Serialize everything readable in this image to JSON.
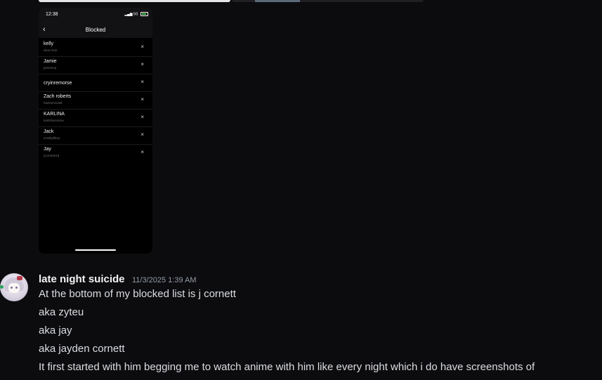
{
  "phone_screenshot": {
    "time": "12:38",
    "status_icons": "5G",
    "title": "Blocked",
    "back_icon": "chevron-left-icon",
    "blocked_users": [
      {
        "name": "kelly",
        "handle": "dixon.bxtr"
      },
      {
        "name": "Jamie",
        "handle": "jamie2up"
      },
      {
        "name": "cryinremorse",
        "handle": ""
      },
      {
        "name": "Zach roberts",
        "handle": "hack3mrsn9k"
      },
      {
        "name": "KARLINA",
        "handle": "karlisherninow"
      },
      {
        "name": "Jack",
        "handle": "smallyiltboy"
      },
      {
        "name": "Jay",
        "handle": "jcornett218"
      }
    ],
    "remove_symbol": "×"
  },
  "message": {
    "username": "late night suicide",
    "timestamp": "11/3/2025 1:39 AM",
    "lines": [
      "At the bottom of my blocked list is j cornett",
      "aka zyteu",
      "aka jay",
      "aka jayden cornett",
      "It first started with him begging me to watch anime with him like every night which i do have screenshots of"
    ]
  },
  "colors": {
    "background": "#0c0c0f",
    "username": "#f2f3f5",
    "message_text": "#dbdee1",
    "timestamp": "#949ba4",
    "online": "#23a55a"
  }
}
